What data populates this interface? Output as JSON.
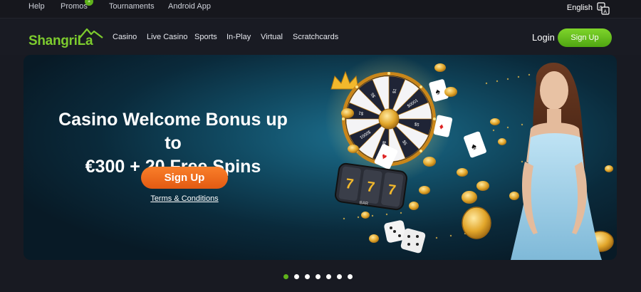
{
  "topbar": {
    "links": [
      "Help",
      "Promos",
      "Tournaments",
      "Android App"
    ],
    "promo_badge": "1",
    "language": "English"
  },
  "nav": {
    "logo_text_1": "Shangri",
    "logo_text_2": "La",
    "items": [
      "Casino",
      "Live Casino",
      "Sports",
      "In-Play",
      "Virtual",
      "Scratchcards"
    ],
    "login": "Login",
    "signup": "Sign Up"
  },
  "hero": {
    "headline_line1": "Casino Welcome Bonus up to",
    "headline_line2": "€300 + 20 Free Spins",
    "signup": "Sign Up",
    "terms": "Terms & Conditions",
    "wheel_labels": [
      "$1",
      "$0001",
      "$5",
      "$5",
      "$0005",
      "$0001",
      "$1",
      "$5"
    ],
    "slot_symbols": [
      "7",
      "7",
      "7"
    ],
    "slot_label": "BAR"
  },
  "carousel": {
    "slide_count": 7,
    "active_index": 0
  },
  "colors": {
    "brand_green": "#5fb21b",
    "cta_orange": "#f26d1d",
    "background": "#181a22"
  }
}
